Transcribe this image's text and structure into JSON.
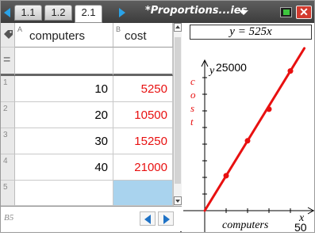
{
  "tabs": [
    {
      "label": "1.1",
      "active": false
    },
    {
      "label": "1.2",
      "active": false
    },
    {
      "label": "2.1",
      "active": true
    }
  ],
  "document_title": "*Proportions...ies",
  "spreadsheet": {
    "columns": [
      {
        "letter": "A",
        "name": "computers"
      },
      {
        "letter": "B",
        "name": "cost"
      }
    ],
    "formula_row_symbol": "=",
    "rows": [
      {
        "num": "1",
        "a": "10",
        "b": "5250"
      },
      {
        "num": "2",
        "a": "20",
        "b": "10500"
      },
      {
        "num": "3",
        "a": "30",
        "b": "15250"
      },
      {
        "num": "4",
        "a": "40",
        "b": "21000"
      },
      {
        "num": "5",
        "a": "",
        "b": ""
      }
    ],
    "selected_cell": "B5",
    "value_color": "#e81010",
    "selection_color": "#a9d3ee"
  },
  "graph": {
    "function_label": "y = 525x",
    "y_axis_var": "y",
    "y_max_label": "25000",
    "y_axis_title": "cost",
    "x_axis_title": "computers",
    "x_max_label": "50",
    "x_axis_var": "x",
    "line_color": "#e81010",
    "points": [
      {
        "x": 10,
        "y": 5250
      },
      {
        "x": 20,
        "y": 10500
      },
      {
        "x": 30,
        "y": 15250
      },
      {
        "x": 40,
        "y": 21000
      }
    ],
    "x_range": [
      0,
      50
    ],
    "y_range": [
      0,
      25000
    ]
  }
}
